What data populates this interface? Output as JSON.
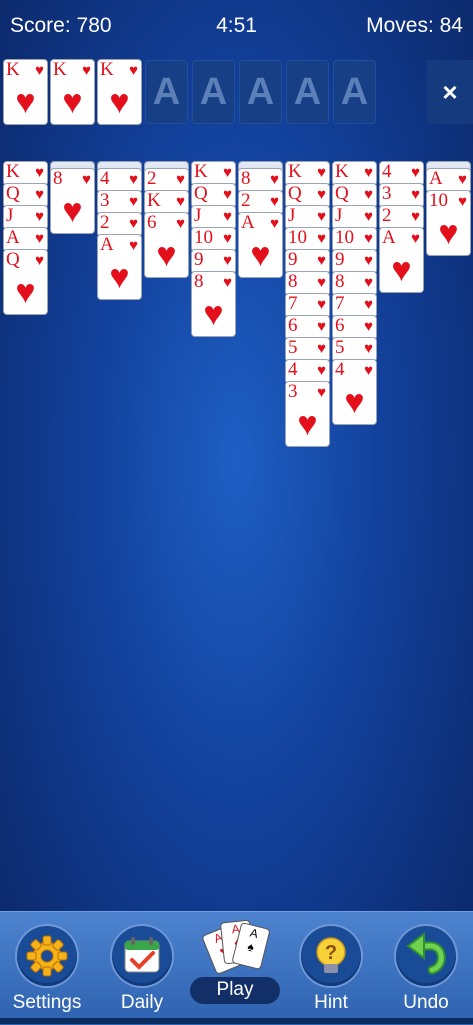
{
  "hud": {
    "score": "Score: 780",
    "timer": "4:51",
    "moves": "Moves: 84"
  },
  "foundations": {
    "completed": [
      {
        "rank": "K",
        "suit": "♥"
      },
      {
        "rank": "K",
        "suit": "♥"
      },
      {
        "rank": "K",
        "suit": "♥"
      }
    ],
    "empty_label": "A",
    "empty_count": 5
  },
  "close_label": "×",
  "colors": {
    "card_red": "#e3101c",
    "felt": "#12409a"
  },
  "tableau": [
    {
      "down": 0,
      "up": [
        {
          "rank": "K",
          "suit": "♥"
        },
        {
          "rank": "Q",
          "suit": "♥"
        },
        {
          "rank": "J",
          "suit": "♥"
        },
        {
          "rank": "A",
          "suit": "♥"
        },
        {
          "rank": "Q",
          "suit": "♥"
        }
      ]
    },
    {
      "down": 1,
      "up": [
        {
          "rank": "8",
          "suit": "♥"
        }
      ]
    },
    {
      "down": 1,
      "up": [
        {
          "rank": "4",
          "suit": "♥"
        },
        {
          "rank": "3",
          "suit": "♥"
        },
        {
          "rank": "2",
          "suit": "♥"
        },
        {
          "rank": "A",
          "suit": "♥"
        }
      ]
    },
    {
      "down": 1,
      "up": [
        {
          "rank": "2",
          "suit": "♥"
        },
        {
          "rank": "K",
          "suit": "♥"
        },
        {
          "rank": "6",
          "suit": "♥"
        }
      ]
    },
    {
      "down": 0,
      "up": [
        {
          "rank": "K",
          "suit": "♥"
        },
        {
          "rank": "Q",
          "suit": "♥"
        },
        {
          "rank": "J",
          "suit": "♥"
        },
        {
          "rank": "10",
          "suit": "♥"
        },
        {
          "rank": "9",
          "suit": "♥"
        },
        {
          "rank": "8",
          "suit": "♥"
        }
      ]
    },
    {
      "down": 1,
      "up": [
        {
          "rank": "8",
          "suit": "♥"
        },
        {
          "rank": "2",
          "suit": "♥"
        },
        {
          "rank": "A",
          "suit": "♥"
        }
      ]
    },
    {
      "down": 0,
      "up": [
        {
          "rank": "K",
          "suit": "♥"
        },
        {
          "rank": "Q",
          "suit": "♥"
        },
        {
          "rank": "J",
          "suit": "♥"
        },
        {
          "rank": "10",
          "suit": "♥"
        },
        {
          "rank": "9",
          "suit": "♥"
        },
        {
          "rank": "8",
          "suit": "♥"
        },
        {
          "rank": "7",
          "suit": "♥"
        },
        {
          "rank": "6",
          "suit": "♥"
        },
        {
          "rank": "5",
          "suit": "♥"
        },
        {
          "rank": "4",
          "suit": "♥"
        },
        {
          "rank": "3",
          "suit": "♥"
        }
      ]
    },
    {
      "down": 0,
      "up": [
        {
          "rank": "K",
          "suit": "♥"
        },
        {
          "rank": "Q",
          "suit": "♥"
        },
        {
          "rank": "J",
          "suit": "♥"
        },
        {
          "rank": "10",
          "suit": "♥"
        },
        {
          "rank": "9",
          "suit": "♥"
        },
        {
          "rank": "8",
          "suit": "♥"
        },
        {
          "rank": "7",
          "suit": "♥"
        },
        {
          "rank": "6",
          "suit": "♥"
        },
        {
          "rank": "5",
          "suit": "♥"
        },
        {
          "rank": "4",
          "suit": "♥"
        }
      ]
    },
    {
      "down": 0,
      "up": [
        {
          "rank": "4",
          "suit": "♥"
        },
        {
          "rank": "3",
          "suit": "♥"
        },
        {
          "rank": "2",
          "suit": "♥"
        },
        {
          "rank": "A",
          "suit": "♥"
        }
      ]
    },
    {
      "down": 1,
      "up": [
        {
          "rank": "A",
          "suit": "♥"
        },
        {
          "rank": "10",
          "suit": "♥"
        }
      ]
    }
  ],
  "nav": {
    "settings": {
      "label": "Settings",
      "icon": "gear-icon"
    },
    "daily": {
      "label": "Daily",
      "icon": "calendar-check-icon"
    },
    "play": {
      "label": "Play",
      "icon": "playing-cards-icon"
    },
    "hint": {
      "label": "Hint",
      "icon": "lightbulb-question-icon"
    },
    "undo": {
      "label": "Undo",
      "icon": "undo-arrow-icon"
    }
  }
}
